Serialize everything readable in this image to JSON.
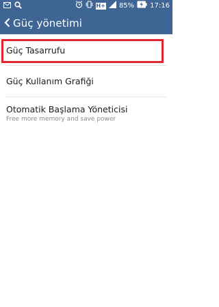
{
  "status_bar": {
    "icons": [
      "mail-icon",
      "search-icon",
      "alarm-icon",
      "vibrate-icon",
      "hplus-signal-icon",
      "cell-signal-icon",
      "battery-charging-icon"
    ],
    "network_label": "H+",
    "battery_percent": "85%",
    "time": "17:16"
  },
  "action_bar": {
    "back_icon": "chevron-left-icon",
    "title": "Güç yönetimi"
  },
  "menu": {
    "items": [
      {
        "title": "Güç Tasarrufu",
        "subtitle": ""
      },
      {
        "title": "Güç Kullanım Grafiği",
        "subtitle": ""
      },
      {
        "title": "Otomatik Başlama Yöneticisi",
        "subtitle": "Free more memory and save power"
      }
    ]
  },
  "colors": {
    "bar": "#3f6594",
    "highlight": "#e0262f"
  }
}
